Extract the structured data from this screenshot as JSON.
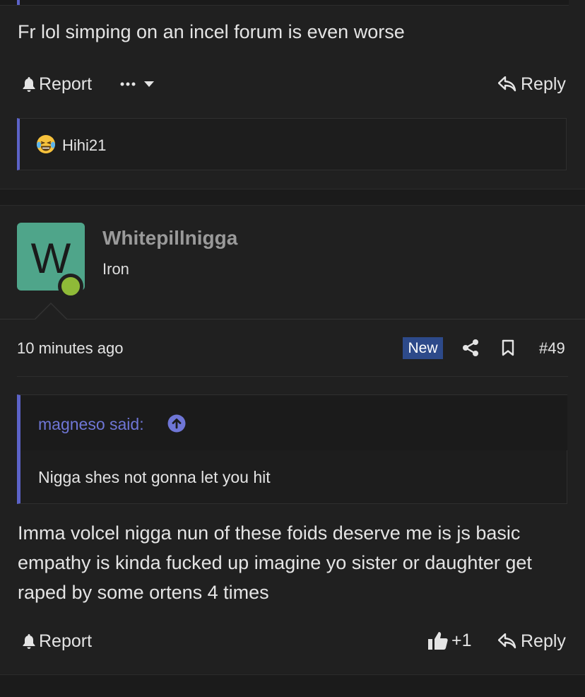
{
  "post1": {
    "body": "Fr lol simping on an incel forum is even worse",
    "report_label": "Report",
    "reply_label": "Reply",
    "reaction_user": "Hihi21"
  },
  "post2": {
    "avatar_letter": "W",
    "username": "Whitepillnigga",
    "user_title": "Iron",
    "timestamp": "10 minutes ago",
    "new_badge": "New",
    "post_number": "#49",
    "quote_author": "magneso said:",
    "quote_text": "Nigga shes not gonna let you hit",
    "body": "Imma volcel nigga nun of these foids deserve me is js basic empathy is kinda fucked up imagine yo sister or daughter get raped by some ortens 4 times",
    "report_label": "Report",
    "reaction_count": "+1",
    "reply_label": "Reply"
  },
  "colors": {
    "background": "#202020",
    "accent": "#5c63c8",
    "avatar": "#4fa58a",
    "online": "#8fba38",
    "badge": "#2d4a8a"
  }
}
